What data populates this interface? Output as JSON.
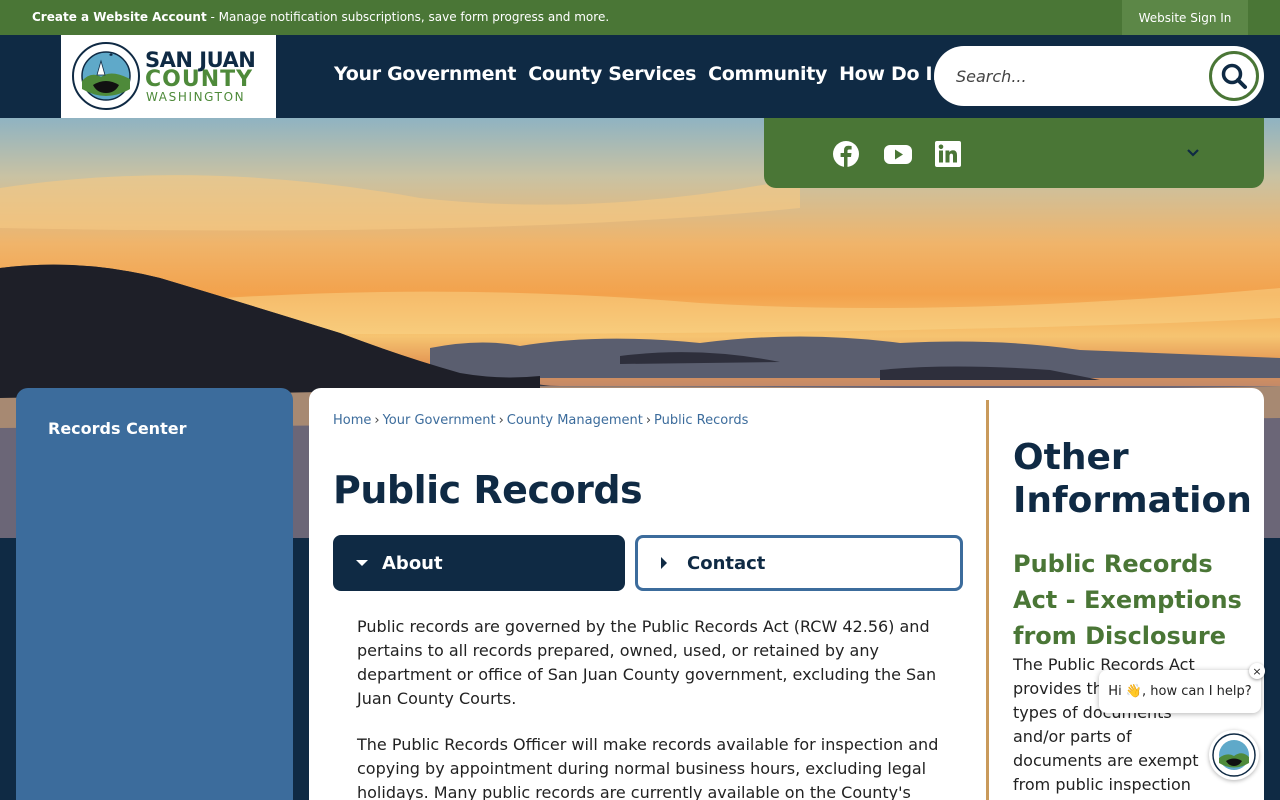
{
  "topbar": {
    "account_link": "Create a Website Account",
    "account_text": " - Manage notification subscriptions, save form progress and more.",
    "signin_label": "Website Sign In"
  },
  "logo": {
    "line1": "SAN JUAN",
    "line2": "COUNTY",
    "line3": "WASHINGTON",
    "seal_text_top": "SAN JUAN COUNTY",
    "seal_text_bottom": "WASHINGTON"
  },
  "nav": {
    "items": [
      "Your Government",
      "County Services",
      "Community",
      "How Do I..."
    ]
  },
  "search": {
    "placeholder": "Search..."
  },
  "social": {
    "icons": [
      "facebook-icon",
      "youtube-icon",
      "linkedin-icon",
      "chevron-down-icon"
    ]
  },
  "sidebar": {
    "items": [
      {
        "label": "Records Center"
      }
    ]
  },
  "breadcrumb": {
    "items": [
      "Home",
      "Your Government",
      "County Management",
      "Public Records"
    ],
    "separator": "›"
  },
  "page": {
    "title": "Public Records",
    "tabs": [
      {
        "label": "About",
        "expanded": true
      },
      {
        "label": "Contact",
        "expanded": false
      }
    ],
    "paragraphs": [
      "Public records are governed by the Public Records Act (RCW 42.56) and pertains to all records prepared, owned, used, or retained by any department or office of San Juan County government, excluding the San Juan County Courts.",
      "The Public Records Officer will make records available for inspection and copying by appointment during normal business hours, excluding legal holidays. Many public records are currently available on the County's website"
    ]
  },
  "other_info": {
    "title": "Other Information",
    "subtitle": "Public Records Act - Exemptions from Disclosure",
    "text": "The Public Records Act provides that certain types of documents and/or parts of documents are exempt from public inspection and copying. To"
  },
  "chat": {
    "greeting": "Hi 👋, how can I help?",
    "close": "×"
  },
  "colors": {
    "navy": "#0f2a44",
    "green": "#4a7636",
    "blue": "#3c6c9c",
    "gold": "#c99a5b"
  }
}
